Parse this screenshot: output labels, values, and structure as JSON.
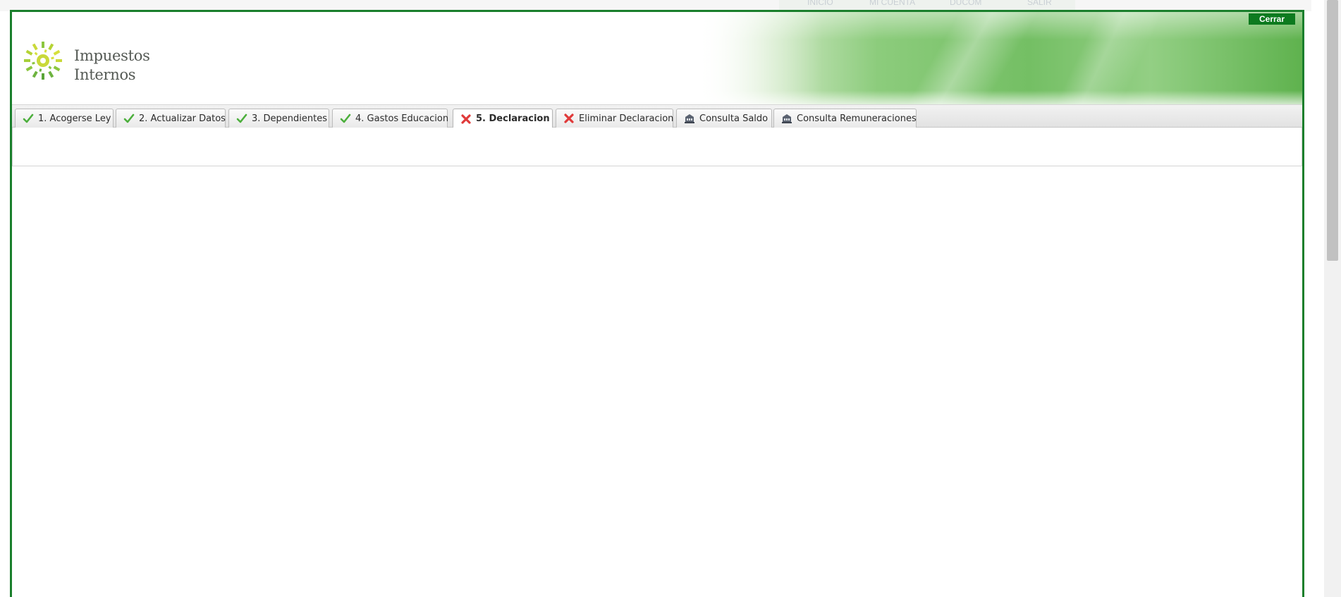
{
  "background_nav": [
    "INICIO",
    "MI CUENTA",
    "DUCOM",
    "SALIR"
  ],
  "header": {
    "logo_line1": "Impuestos",
    "logo_line2": "Internos",
    "close_label": "Cerrar"
  },
  "tabs": [
    {
      "label": "1. Acogerse Ley",
      "icon": "check-icon"
    },
    {
      "label": "2. Actualizar Datos",
      "icon": "check-icon"
    },
    {
      "label": "3. Dependientes",
      "icon": "check-icon"
    },
    {
      "label": "4. Gastos Educacion",
      "icon": "check-icon"
    },
    {
      "label": "5. Declaracion",
      "icon": "x-icon",
      "active": true
    },
    {
      "label": "Eliminar Declaracion",
      "icon": "x-icon"
    },
    {
      "label": "Consulta Saldo",
      "icon": "building-icon"
    },
    {
      "label": "Consulta Remuneraciones",
      "icon": "building-icon"
    }
  ],
  "colors": {
    "frame": "#1a7f2c",
    "close_button": "#0d7a1f",
    "check": "#4caf3c",
    "x": "#e03a3a"
  }
}
